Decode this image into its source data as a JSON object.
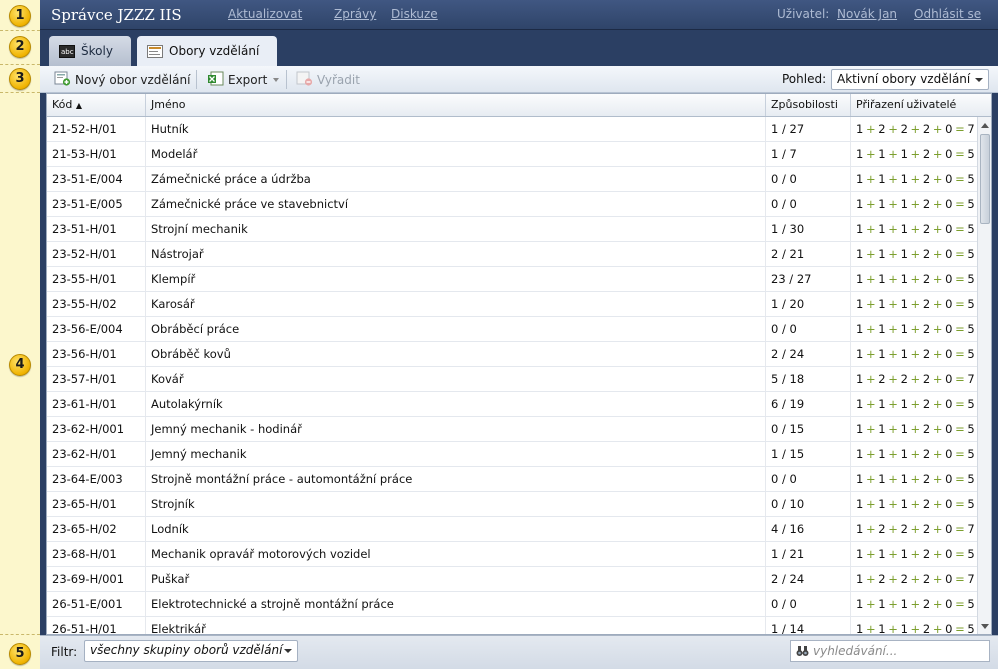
{
  "annotations": [
    "1",
    "2",
    "3",
    "4",
    "5"
  ],
  "header": {
    "title": "Správce JZZZ IIS",
    "nav": [
      "Aktualizovat",
      "Zprávy",
      "Diskuze"
    ],
    "user_label": "Uživatel:",
    "user_name": "Novák Jan",
    "logout": "Odhlásit se"
  },
  "tabs": [
    {
      "label": "Školy",
      "icon": "abc-icon",
      "active": false
    },
    {
      "label": "Obory vzdělání",
      "icon": "document-icon",
      "active": true
    }
  ],
  "toolbar": {
    "new_label": "Nový obor vzdělání",
    "export_label": "Export",
    "remove_label": "Vyřadit",
    "view_label": "Pohled:",
    "view_value": "Aktivní obory vzdělání"
  },
  "table": {
    "columns": [
      "Kód",
      "Jméno",
      "Způsobilosti",
      "Přiřazení uživatelé"
    ],
    "sort_indicator": "▲",
    "rows": [
      {
        "code": "21-52-H/01",
        "name": "Hutník",
        "competences": "1 / 27",
        "users": [
          "1",
          "2",
          "2",
          "2",
          "0",
          "7"
        ]
      },
      {
        "code": "21-53-H/01",
        "name": "Modelář",
        "competences": "1 / 7",
        "users": [
          "1",
          "1",
          "1",
          "2",
          "0",
          "5"
        ]
      },
      {
        "code": "23-51-E/004",
        "name": "Zámečnické práce a údržba",
        "competences": "0 / 0",
        "users": [
          "1",
          "1",
          "1",
          "2",
          "0",
          "5"
        ]
      },
      {
        "code": "23-51-E/005",
        "name": "Zámečnické práce ve stavebnictví",
        "competences": "0 / 0",
        "users": [
          "1",
          "1",
          "1",
          "2",
          "0",
          "5"
        ]
      },
      {
        "code": "23-51-H/01",
        "name": "Strojní mechanik",
        "competences": "1 / 30",
        "users": [
          "1",
          "1",
          "1",
          "2",
          "0",
          "5"
        ]
      },
      {
        "code": "23-52-H/01",
        "name": "Nástrojař",
        "competences": "2 / 21",
        "users": [
          "1",
          "1",
          "1",
          "2",
          "0",
          "5"
        ]
      },
      {
        "code": "23-55-H/01",
        "name": "Klempíř",
        "competences": "23 / 27",
        "users": [
          "1",
          "1",
          "1",
          "2",
          "0",
          "5"
        ]
      },
      {
        "code": "23-55-H/02",
        "name": "Karosář",
        "competences": "1 / 20",
        "users": [
          "1",
          "1",
          "1",
          "2",
          "0",
          "5"
        ]
      },
      {
        "code": "23-56-E/004",
        "name": "Obráběcí práce",
        "competences": "0 / 0",
        "users": [
          "1",
          "1",
          "1",
          "2",
          "0",
          "5"
        ]
      },
      {
        "code": "23-56-H/01",
        "name": "Obráběč kovů",
        "competences": "2 / 24",
        "users": [
          "1",
          "1",
          "1",
          "2",
          "0",
          "5"
        ]
      },
      {
        "code": "23-57-H/01",
        "name": "Kovář",
        "competences": "5 / 18",
        "users": [
          "1",
          "2",
          "2",
          "2",
          "0",
          "7"
        ]
      },
      {
        "code": "23-61-H/01",
        "name": "Autolakýrník",
        "competences": "6 / 19",
        "users": [
          "1",
          "1",
          "1",
          "2",
          "0",
          "5"
        ]
      },
      {
        "code": "23-62-H/001",
        "name": "Jemný mechanik - hodinář",
        "competences": "0 / 15",
        "users": [
          "1",
          "1",
          "1",
          "2",
          "0",
          "5"
        ]
      },
      {
        "code": "23-62-H/01",
        "name": "Jemný mechanik",
        "competences": "1 / 15",
        "users": [
          "1",
          "1",
          "1",
          "2",
          "0",
          "5"
        ]
      },
      {
        "code": "23-64-E/003",
        "name": "Strojně montážní práce - automontážní práce",
        "competences": "0 / 0",
        "users": [
          "1",
          "1",
          "1",
          "2",
          "0",
          "5"
        ]
      },
      {
        "code": "23-65-H/01",
        "name": "Strojník",
        "competences": "0 / 10",
        "users": [
          "1",
          "1",
          "1",
          "2",
          "0",
          "5"
        ]
      },
      {
        "code": "23-65-H/02",
        "name": "Lodník",
        "competences": "4 / 16",
        "users": [
          "1",
          "2",
          "2",
          "2",
          "0",
          "7"
        ]
      },
      {
        "code": "23-68-H/01",
        "name": "Mechanik opravář motorových vozidel",
        "competences": "1 / 21",
        "users": [
          "1",
          "1",
          "1",
          "2",
          "0",
          "5"
        ]
      },
      {
        "code": "23-69-H/001",
        "name": "Puškař",
        "competences": "2 / 24",
        "users": [
          "1",
          "2",
          "2",
          "2",
          "0",
          "7"
        ]
      },
      {
        "code": "26-51-E/001",
        "name": "Elektrotechnické a strojně montážní práce",
        "competences": "0 / 0",
        "users": [
          "1",
          "1",
          "1",
          "2",
          "0",
          "5"
        ]
      },
      {
        "code": "26-51-H/01",
        "name": "Elektrikář",
        "competences": "1 / 14",
        "users": [
          "1",
          "1",
          "1",
          "2",
          "0",
          "5"
        ]
      }
    ]
  },
  "footer": {
    "filter_label": "Filtr:",
    "filter_value": "všechny skupiny oborů vzdělání",
    "search_placeholder": "vyhledávání..."
  },
  "colors": {
    "topbar": "#34496f",
    "accent_plus": "#7c9f2d",
    "marker": "#f5c000"
  }
}
